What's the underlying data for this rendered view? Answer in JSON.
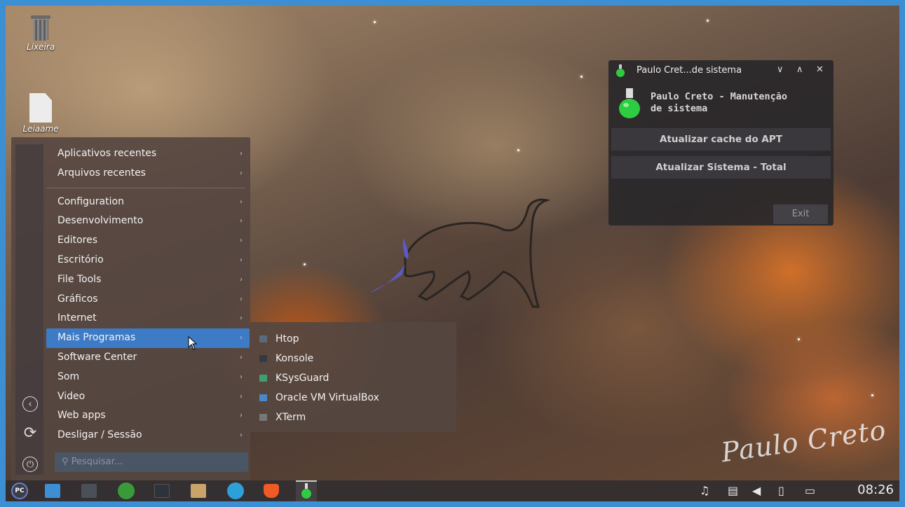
{
  "desktop": {
    "icons": [
      {
        "label": "Lixeira",
        "icon": "trash-icon"
      },
      {
        "label": "Leiaame",
        "icon": "text-file-icon"
      }
    ],
    "signature": "Paulo Creto"
  },
  "app_menu": {
    "groups": [
      [
        "Aplicativos recentes",
        "Arquivos recentes"
      ],
      [
        "Configuration",
        "Desenvolvimento",
        "Editores",
        "Escritório",
        "File Tools",
        "Gráficos",
        "Internet",
        "Mais Programas",
        "Software Center",
        "Som",
        "Video",
        "Web apps",
        "Desligar / Sessão"
      ]
    ],
    "active_item": "Mais Programas",
    "search_placeholder": "Pesquisar...",
    "side_icons": [
      "back-icon",
      "refresh-icon",
      "power-icon"
    ]
  },
  "submenu": {
    "items": [
      {
        "label": "Htop",
        "icon": "terminal-icon",
        "color": "#5a6a7a"
      },
      {
        "label": "Konsole",
        "icon": "konsole-icon",
        "color": "#333a44"
      },
      {
        "label": "KSysGuard",
        "icon": "chart-icon",
        "color": "#3ea06e"
      },
      {
        "label": "Oracle VM VirtualBox",
        "icon": "virtualbox-icon",
        "color": "#4a88c8"
      },
      {
        "label": "XTerm",
        "icon": "xterm-icon",
        "color": "#777777"
      }
    ]
  },
  "maintenance_window": {
    "title": "Paulo Cret...de sistema",
    "heading_line1": "Paulo Creto - Manutenção",
    "heading_line2": "de sistema",
    "buttons": [
      "Atualizar cache do APT",
      "Atualizar Sistema - Total"
    ],
    "exit_label": "Exit"
  },
  "taskbar": {
    "apps": [
      "kickoff-menu-icon",
      "file-manager-icon",
      "settings-icon",
      "xbox-icon",
      "terminal-icon",
      "archive-icon",
      "telegram-icon",
      "brave-icon",
      "maintenance-flask-icon"
    ],
    "tray": [
      "notification-icon",
      "clipboard-icon",
      "volume-icon",
      "battery-icon",
      "network-icon"
    ],
    "clock": "08:26"
  }
}
